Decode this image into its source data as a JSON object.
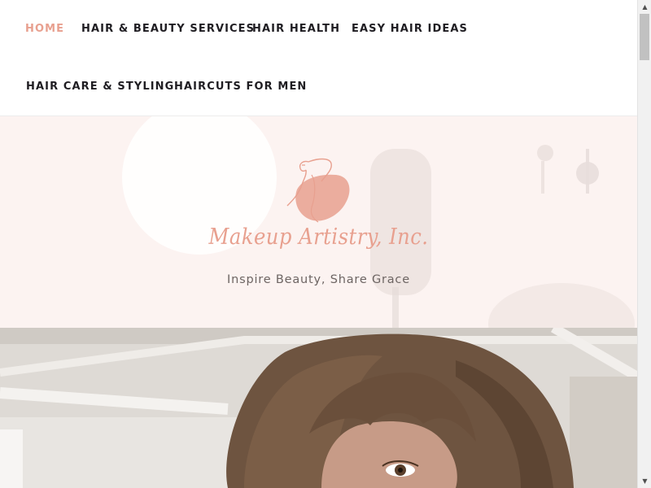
{
  "nav": {
    "items": [
      {
        "label": "HOME",
        "active": true
      },
      {
        "label": "HAIR & BEAUTY SERVICES",
        "active": false
      },
      {
        "label": "HAIR HEALTH",
        "active": false
      },
      {
        "label": "EASY HAIR IDEAS",
        "active": false
      },
      {
        "label": "HAIR CARE & STYLING",
        "active": false
      },
      {
        "label": "HAIRCUTS FOR MEN",
        "active": false
      }
    ]
  },
  "hero": {
    "site_title": "Makeup Artistry, Inc.",
    "tagline": "Inspire Beauty, Share Grace",
    "logo_icon": "woman-silhouette-logo-icon"
  },
  "colors": {
    "accent": "#e8a08f",
    "nav_text": "#1f1d22",
    "tagline_text": "#6d6563",
    "hero_bg": "#fcf3f1"
  },
  "scrollbar": {
    "up_icon": "scroll-up-arrow-icon",
    "down_icon": "scroll-down-arrow-icon"
  }
}
